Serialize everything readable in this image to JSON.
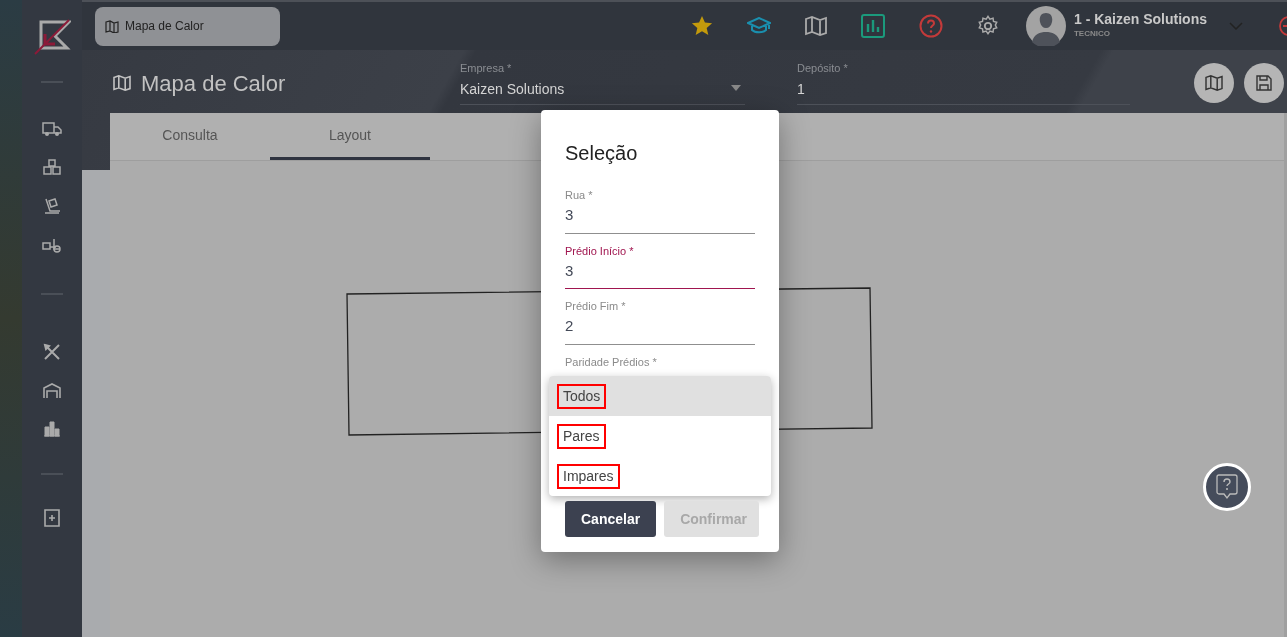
{
  "breadcrumb": {
    "label": "Mapa de Calor"
  },
  "user": {
    "name": "1 - Kaizen Solutions",
    "role": "TECNICO"
  },
  "page_title": "Mapa de Calor",
  "filters": [
    {
      "label": "Empresa *",
      "value": "Kaizen Solutions",
      "kind": "select"
    },
    {
      "label": "Depósito *",
      "value": "1",
      "kind": "text"
    }
  ],
  "tabs": [
    {
      "label": "Consulta",
      "selected": false
    },
    {
      "label": "Layout",
      "selected": true
    }
  ],
  "dialog": {
    "title": "Seleção",
    "fields": [
      {
        "label": "Rua *",
        "value": "3",
        "focused": false
      },
      {
        "label": "Prédio Início *",
        "value": "3",
        "focused": true
      },
      {
        "label": "Prédio Fim *",
        "value": "2",
        "focused": false
      },
      {
        "label": "Paridade Prédios *",
        "focused": false
      }
    ],
    "options": [
      {
        "label": "Todos",
        "selected": true,
        "highlighted": true
      },
      {
        "label": "Pares",
        "selected": false,
        "highlighted": true
      },
      {
        "label": "Impares",
        "selected": false,
        "highlighted": true
      }
    ],
    "buttons": [
      {
        "label": "Cancelar",
        "disabled": false
      },
      {
        "label": "Confirmar",
        "disabled": true
      }
    ]
  }
}
